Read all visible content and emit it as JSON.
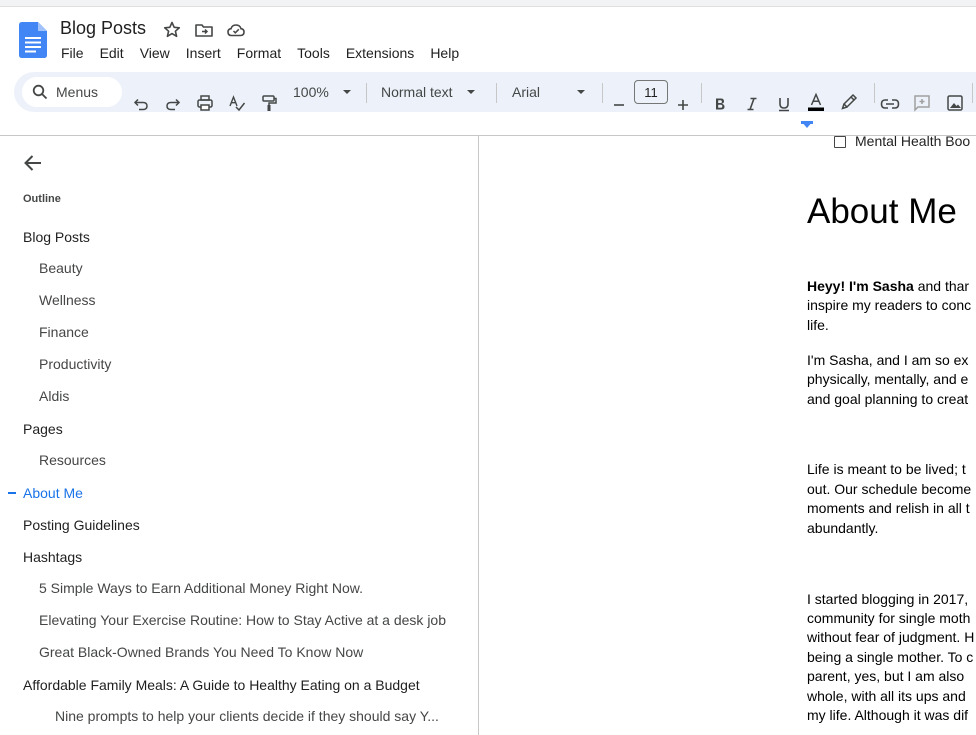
{
  "app": {
    "title": "Blog Posts",
    "menu": [
      "File",
      "Edit",
      "View",
      "Insert",
      "Format",
      "Tools",
      "Extensions",
      "Help"
    ]
  },
  "toolbar": {
    "search_placeholder": "Menus",
    "zoom": "100%",
    "style": "Normal text",
    "font": "Arial",
    "font_size": "11",
    "icons": [
      "undo-icon",
      "redo-icon",
      "print-icon",
      "spellcheck-icon",
      "paint-format-icon",
      "decrease-size-icon",
      "increase-size-icon",
      "bold-icon",
      "italic-icon",
      "underline-icon",
      "text-color-icon",
      "highlight-icon",
      "link-icon",
      "add-comment-icon",
      "insert-image-icon"
    ],
    "text_color": "#000000"
  },
  "outline": {
    "label": "Outline",
    "items": [
      {
        "text": "Blog Posts",
        "level": 1
      },
      {
        "text": "Beauty",
        "level": 2
      },
      {
        "text": "Wellness",
        "level": 2
      },
      {
        "text": "Finance",
        "level": 2
      },
      {
        "text": "Productivity",
        "level": 2
      },
      {
        "text": "Aldis",
        "level": 2
      },
      {
        "text": "Pages",
        "level": 1
      },
      {
        "text": "Resources",
        "level": 2
      },
      {
        "text": "About Me",
        "level": 1,
        "active": true
      },
      {
        "text": "Posting Guidelines",
        "level": 1
      },
      {
        "text": "Hashtags",
        "level": 1
      },
      {
        "text": "5 Simple Ways to Earn Additional Money Right Now.",
        "level": 2
      },
      {
        "text": "Elevating Your Exercise Routine: How to Stay Active at a desk job",
        "level": 2
      },
      {
        "text": "Great Black-Owned Brands You Need To Know Now",
        "level": 2
      },
      {
        "text": "Affordable Family Meals: A Guide to Healthy Eating on a Budget",
        "level": 1
      },
      {
        "text": "Nine prompts to help your clients decide if they should say Y...",
        "level": 3
      }
    ]
  },
  "document": {
    "checklist_item": "Mental Health Boo",
    "heading": "About Me",
    "paragraph1": {
      "bold": "Heyy! I'm Sasha",
      "rest": " and thar",
      "lines": [
        "inspire my readers to conc",
        "life."
      ]
    },
    "paragraph2": [
      "I'm Sasha, and I am so ex",
      "physically, mentally, and e",
      "and goal planning to creat"
    ],
    "paragraph3": [
      "Life is meant to be lived; t",
      "out. Our schedule become",
      "moments and relish in all t",
      "abundantly."
    ],
    "paragraph4": [
      "I started blogging in 2017,",
      "community for single moth",
      "without fear of judgment. H",
      "being a single mother. To c",
      "parent, yes, but I am also",
      "whole, with all its ups and",
      "my life. Although it was dif"
    ]
  },
  "colors": {
    "accent": "#1a73e8",
    "toolbar_bg": "#edf2fa",
    "docs_blue": "#4285f4"
  }
}
